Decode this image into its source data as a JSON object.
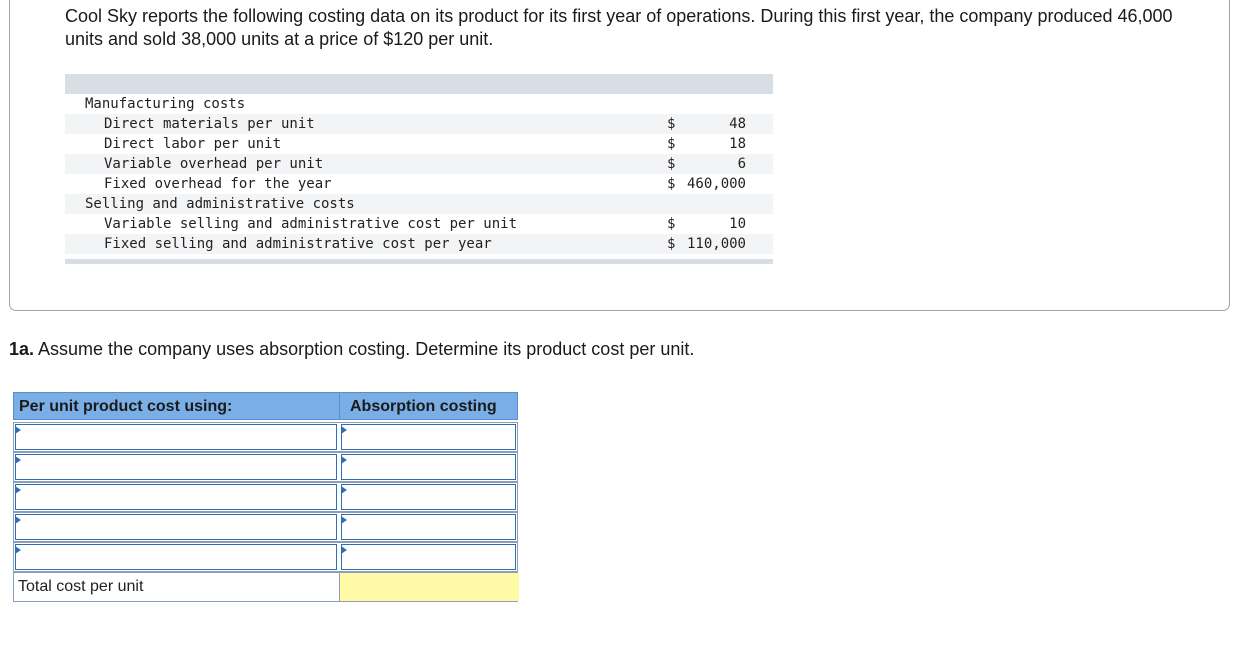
{
  "intro": {
    "text": "Cool Sky reports the following costing data on its product for its first year of operations. During this first year, the company produced 46,000 units and sold 38,000 units at a price of $120 per unit."
  },
  "cost_data": {
    "rows": [
      {
        "label": "Manufacturing costs",
        "currency": "",
        "amount": "",
        "indent": 1,
        "shaded": false
      },
      {
        "label": "Direct materials per unit",
        "currency": "$",
        "amount": "48",
        "indent": 2,
        "shaded": true
      },
      {
        "label": "Direct labor per unit",
        "currency": "$",
        "amount": "18",
        "indent": 2,
        "shaded": false
      },
      {
        "label": "Variable overhead per unit",
        "currency": "$",
        "amount": "6",
        "indent": 2,
        "shaded": true
      },
      {
        "label": "Fixed overhead for the year",
        "currency": "$",
        "amount": "460,000",
        "indent": 2,
        "shaded": false
      },
      {
        "label": "Selling and administrative costs",
        "currency": "",
        "amount": "",
        "indent": 1,
        "shaded": true
      },
      {
        "label": "Variable selling and administrative cost per unit",
        "currency": "$",
        "amount": "10",
        "indent": 2,
        "shaded": false
      },
      {
        "label": "Fixed selling and administrative cost per year",
        "currency": "$",
        "amount": "110,000",
        "indent": 2,
        "shaded": true
      }
    ]
  },
  "question": {
    "number": "1a.",
    "text": " Assume the company uses absorption costing. Determine its product cost per unit."
  },
  "answer_table": {
    "header_left": "Per unit product cost using:",
    "header_right": "Absorption costing",
    "input_rows": [
      {
        "label_value": "",
        "amount_value": ""
      },
      {
        "label_value": "",
        "amount_value": ""
      },
      {
        "label_value": "",
        "amount_value": ""
      },
      {
        "label_value": "",
        "amount_value": ""
      },
      {
        "label_value": "",
        "amount_value": ""
      }
    ],
    "total_label": "Total cost per unit",
    "total_value": "",
    "colors": {
      "header_bg": "#7aaee6",
      "total_bg": "#fffaa5",
      "input_border": "#2f6db5"
    }
  }
}
